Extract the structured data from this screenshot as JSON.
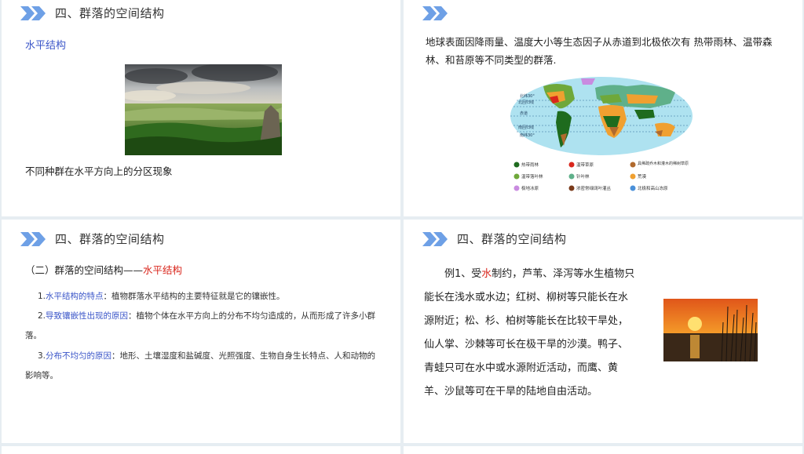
{
  "slides": {
    "s1": {
      "heading": "四、群落的空间结构",
      "subtitle": "水平结构",
      "caption": "不同种群在水平方向上的分区现象"
    },
    "s2": {
      "text": "地球表面因降雨量、温度大小等生态因子从赤道到北极依次有   热带雨林、温带森林、和苔原等不同类型的群落.",
      "map": {
        "lat_labels": [
          "北纬30°",
          "北回归线",
          "赤道",
          "南回归线",
          "南纬30°"
        ],
        "legend": [
          {
            "label": "热带雨林",
            "color": "#1e6b1e"
          },
          {
            "label": "温带草原",
            "color": "#d9261c"
          },
          {
            "label": "具稀疏乔木和灌木的稀树草原",
            "color": "#b06a2e"
          },
          {
            "label": "温带落叶林",
            "color": "#6fa83a"
          },
          {
            "label": "针叶林",
            "color": "#5fb08a"
          },
          {
            "label": "荒漠",
            "color": "#f0a030"
          },
          {
            "label": "极地冰原",
            "color": "#c98be0"
          },
          {
            "label": "浓密常绿阔叶灌丛",
            "color": "#7a3a1a"
          },
          {
            "label": "北极和高山冻原",
            "color": "#4a90d9"
          }
        ]
      }
    },
    "s3": {
      "heading": "四、群落的空间结构",
      "intro_prefix": "（二）群落的空间结构——",
      "intro_highlight": "水平结构",
      "items": [
        {
          "num": "1.",
          "term": "水平结构的特点",
          "text": "：植物群落水平结构的主要特征就是它的镶嵌性。"
        },
        {
          "num": "2.",
          "term": "导致镶嵌性出现的原因",
          "text": "：植物个体在水平方向上的分布不均匀造成的，从而形成了许多小群落。"
        },
        {
          "num": "3.",
          "term": "分布不均匀的原因",
          "text": "：地形、土壤湿度和盐碱度、光照强度、生物自身生长特点、人和动物的影响等。"
        }
      ]
    },
    "s4": {
      "heading": "四、群落的空间结构",
      "example_prefix": "例1、受",
      "example_highlight": "水",
      "example_rest": "制约，芦苇、泽泻等水生植物只能长在浅水或水边；红树、柳树等只能长在水源附近；松、杉、柏树等能长在比较干旱处，仙人掌、沙棘等可长在极干旱的沙漠。鸭子、青蛙只可在水中或水源附近活动，而鹰、黄羊、沙鼠等可在干旱的陆地自由活动。"
    }
  },
  "colors": {
    "accent": "#6ea0e6",
    "highlight_red": "#d9261c",
    "highlight_blue": "#3a55c8"
  }
}
